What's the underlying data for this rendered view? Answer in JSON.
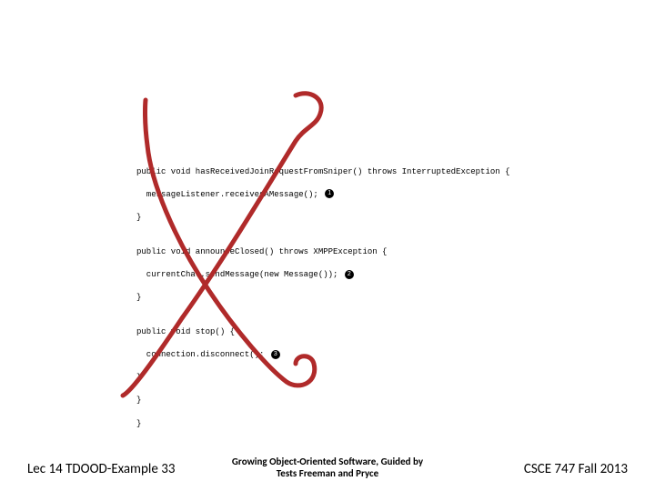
{
  "code": {
    "l1": "public void hasReceivedJoinRequestFromSniper() throws InterruptedException {",
    "l2": "  messageListener.receivesAMessage();",
    "l3": "}",
    "l4": "",
    "l5": "public void announceClosed() throws XMPPException {",
    "l6": "  currentChat.sendMessage(new Message());",
    "l7": "}",
    "l8": "",
    "l9": "public void stop() {",
    "l10": "  connection.disconnect();",
    "l11": "}",
    "l12": "}",
    "l13": "}",
    "num1": "1",
    "num2": "2",
    "num3": "3"
  },
  "footer": {
    "left": "Lec 14 TDOOD-Example 33",
    "center_line1": "Growing Object-Oriented Software, Guided by",
    "center_line2": "Tests Freeman and Pryce",
    "right": "CSCE 747 Fall 2013"
  },
  "annotation": {
    "stroke": "#b02a2a"
  }
}
